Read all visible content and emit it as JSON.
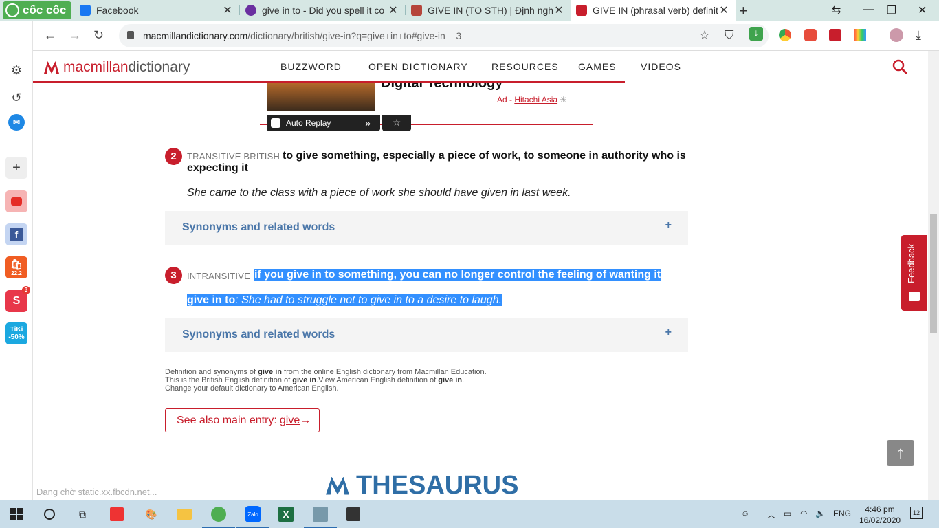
{
  "browser": {
    "brand": "cốc cốc",
    "tabs": [
      {
        "title": "Facebook",
        "color": "#1877f2"
      },
      {
        "title": "give in to - Did you spell it co",
        "color": "#6a2fa0"
      },
      {
        "title": "GIVE IN (TO STH) | Định nghĩa",
        "color": "#b5453b"
      },
      {
        "title": "GIVE IN (phrasal verb) definiti",
        "color": "#c81e2c",
        "active": true
      }
    ],
    "url_host": "macmillandictionary.com",
    "url_path": "/dictionary/british/give-in?q=give+in+to#give-in__3",
    "status_text": "Đang chờ static.xx.fbcdn.net..."
  },
  "site": {
    "logo": "macmillan",
    "logo_suffix": " dictionary",
    "nav": [
      "BUZZWORD",
      "OPEN DICTIONARY",
      "RESOURCES",
      "GAMES",
      "VIDEOS"
    ]
  },
  "ad": {
    "title": "Digital Technology",
    "prefix": "Ad - ",
    "advertiser": "Hitachi Asia",
    "replay_label": "Auto Replay"
  },
  "senses": [
    {
      "number": "2",
      "tags": "TRANSITIVE  BRITISH",
      "definition_line1": "to give something, especially a piece of work, to someone in authority who is",
      "definition_line2": "expecting it",
      "example": "She came to the class with a piece of work she should have given in last week."
    },
    {
      "number": "3",
      "tags": "INTRANSITIVE",
      "definition": "if you give in to something, you can no longer control the feeling of wanting it",
      "example_head": "give in to",
      "example": ": She had to struggle not to give in to a desire to laugh."
    }
  ],
  "synonyms_label": "Synonyms and related words",
  "footer": {
    "line1_a": "Definition and synonyms of ",
    "line1_b": "give in",
    "line1_c": " from the online English dictionary from Macmillan Education.",
    "line2_a": "This is the British English definition of ",
    "line2_b": "give in",
    "line2_c": ".View American English definition of ",
    "line2_d": "give in",
    "line2_e": ".",
    "line3": "Change your default dictionary to American English."
  },
  "see_also": {
    "prefix": "See also main entry: ",
    "link": "give"
  },
  "thesaurus": "THESAURUS",
  "feedback": "Feedback",
  "taskbar": {
    "lang": "ENG",
    "time": "4:46 pm",
    "date": "16/02/2020",
    "notifications": "12"
  },
  "sidebar_badge": "3",
  "sidebar_tiki": "TiKi -50%",
  "sidebar_shopee": "22.2"
}
